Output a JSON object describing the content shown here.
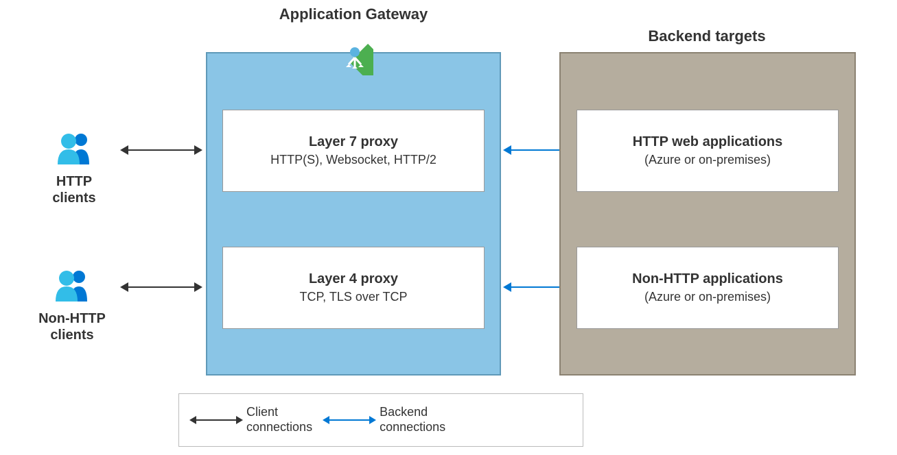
{
  "gateway": {
    "title": "Application Gateway",
    "proxies": [
      {
        "title": "Layer 7 proxy",
        "sub": "HTTP(S), Websocket, HTTP/2"
      },
      {
        "title": "Layer 4 proxy",
        "sub": "TCP, TLS over TCP"
      }
    ]
  },
  "backend": {
    "title": "Backend targets",
    "targets": [
      {
        "title": "HTTP web applications",
        "sub": "(Azure or on-premises)"
      },
      {
        "title": "Non-HTTP applications",
        "sub": "(Azure or on-premises)"
      }
    ]
  },
  "clients": [
    {
      "label_line1": "HTTP",
      "label_line2": "clients"
    },
    {
      "label_line1": "Non-HTTP",
      "label_line2": "clients"
    }
  ],
  "legend": {
    "client": "Client\nconnections",
    "backend": "Backend\nconnections"
  },
  "colors": {
    "gateway_bg": "#8ac5e6",
    "backend_bg": "#b5ad9e",
    "arrow_client": "#333333",
    "arrow_backend": "#0078d4"
  }
}
